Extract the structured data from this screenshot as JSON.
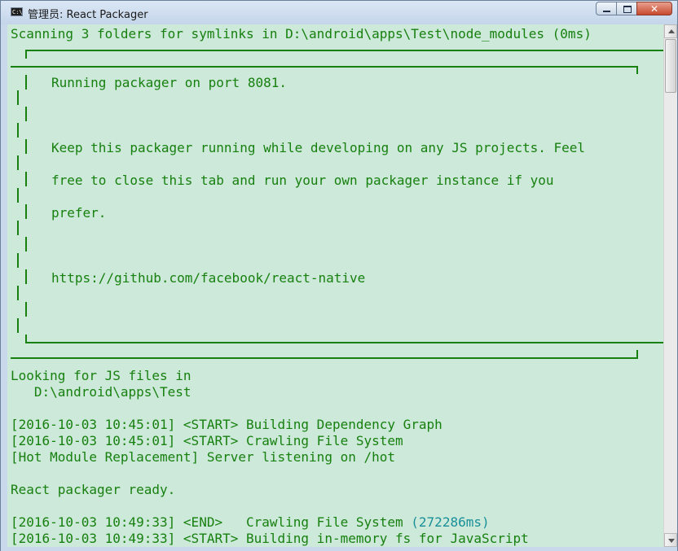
{
  "window": {
    "title": "管理员: React Packager",
    "icon": "cmd-console-icon",
    "icon_text": "C:\\",
    "controls": {
      "minimize": "minimize-icon",
      "maximize": "maximize-icon",
      "close_glyph": "✕"
    }
  },
  "colors": {
    "console_bg": "#cce9d9",
    "text": "#17800f",
    "highlight": "#1a8f9a"
  },
  "console": {
    "scanning": "Scanning 3 folders for symlinks in D:\\android\\apps\\Test\\node_modules (0ms)",
    "banner": {
      "line1": "Running packager on port 8081.",
      "line2": "Keep this packager running while developing on any JS projects. Feel",
      "line3": "free to close this tab and run your own packager instance if you",
      "line4": "prefer.",
      "url": "https://github.com/facebook/react-native"
    },
    "looking_1": "Looking for JS files in",
    "looking_2": "   D:\\android\\apps\\Test",
    "log": [
      {
        "text": "[2016-10-03 10:45:01] <START> Building Dependency Graph"
      },
      {
        "text": "[2016-10-03 10:45:01] <START> Crawling File System"
      },
      {
        "text": "[Hot Module Replacement] Server listening on /hot"
      },
      {
        "text": "React packager ready."
      },
      {
        "text": "[2016-10-03 10:49:33] <END>   Crawling File System ",
        "timing": "(272286ms)"
      },
      {
        "text": "[2016-10-03 10:49:33] <START> Building in-memory fs for JavaScript"
      }
    ]
  }
}
